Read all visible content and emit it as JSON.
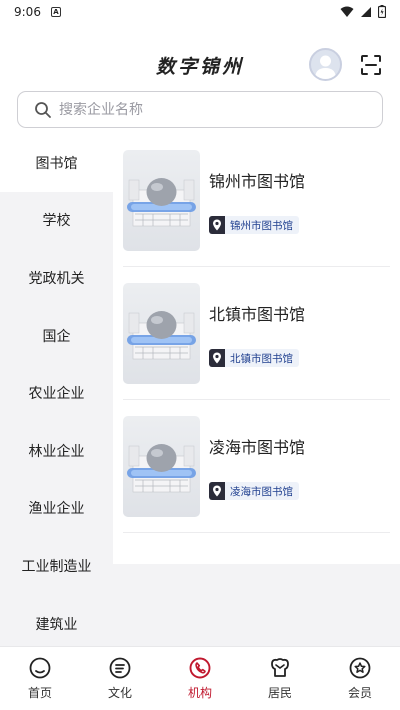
{
  "status_bar": {
    "time": "9:06",
    "notification_glyph": "A"
  },
  "header": {
    "title": "数字锦州"
  },
  "search": {
    "placeholder": "搜索企业名称",
    "value": ""
  },
  "categories": [
    {
      "label": "图书馆",
      "active": true
    },
    {
      "label": "学校"
    },
    {
      "label": "党政机关"
    },
    {
      "label": "国企"
    },
    {
      "label": "农业企业"
    },
    {
      "label": "林业企业"
    },
    {
      "label": "渔业企业"
    },
    {
      "label": "工业制造业"
    },
    {
      "label": "建筑业"
    }
  ],
  "institutions": [
    {
      "name": "锦州市图书馆",
      "location": "锦州市图书馆"
    },
    {
      "name": "北镇市图书馆",
      "location": "北镇市图书馆"
    },
    {
      "name": "凌海市图书馆",
      "location": "凌海市图书馆"
    }
  ],
  "bottom_nav": [
    {
      "label": "首页",
      "icon": "home-icon"
    },
    {
      "label": "文化",
      "icon": "culture-icon"
    },
    {
      "label": "机构",
      "icon": "institution-icon",
      "active": true
    },
    {
      "label": "居民",
      "icon": "residents-icon"
    },
    {
      "label": "会员",
      "icon": "member-icon"
    }
  ],
  "colors": {
    "accent": "#c0182e",
    "tag_bg": "#eef2f9",
    "tag_text": "#1f3f8f",
    "sidebar_bg": "#f3f3f5"
  }
}
